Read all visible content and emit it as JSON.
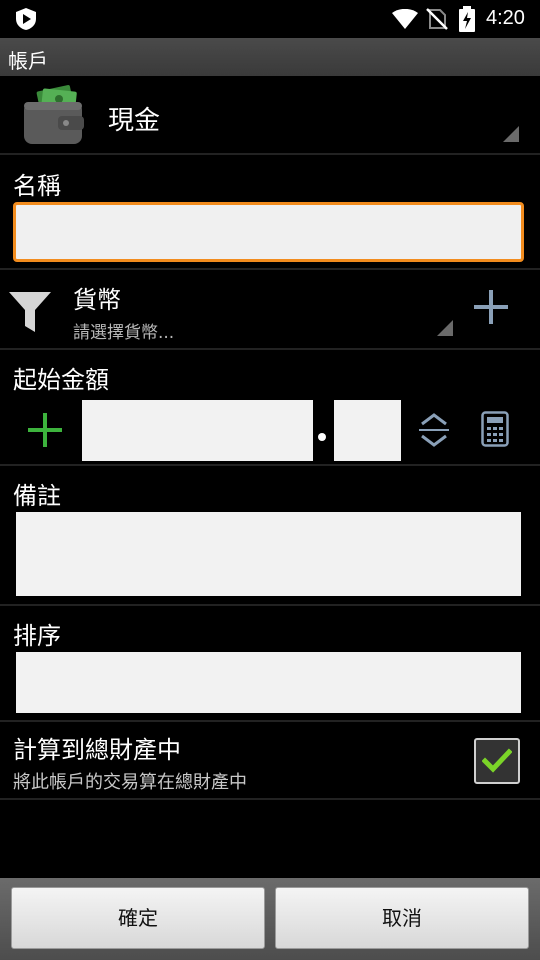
{
  "status_bar": {
    "time": "4:20",
    "icons": [
      "app-shield-icon",
      "wifi-icon",
      "no-sim-icon",
      "battery-charging-icon"
    ]
  },
  "header": {
    "title": "帳戶"
  },
  "account": {
    "name": "現金",
    "icon": "wallet-icon"
  },
  "name_field": {
    "label": "名稱",
    "value": ""
  },
  "currency": {
    "label": "貨幣",
    "placeholder": "請選擇貨幣...",
    "icon": "filter-icon",
    "add_icon": "plus-icon"
  },
  "starting_amount": {
    "label": "起始金額",
    "sign_icon": "plus-icon",
    "integer_value": "",
    "decimal_value": "",
    "separator": ".",
    "stepper_icon": "up-down-icon",
    "calculator_icon": "calculator-icon"
  },
  "note": {
    "label": "備註",
    "value": ""
  },
  "sort": {
    "label": "排序",
    "value": ""
  },
  "include_in_total": {
    "label": "計算到總財產中",
    "description": "將此帳戶的交易算在總財產中",
    "checked": true
  },
  "buttons": {
    "confirm": "確定",
    "cancel": "取消"
  },
  "colors": {
    "focus_border": "#f28c1e",
    "plus_green": "#3db33d",
    "check_green": "#7bd428",
    "bottom_bar": "#5a5a5a"
  }
}
